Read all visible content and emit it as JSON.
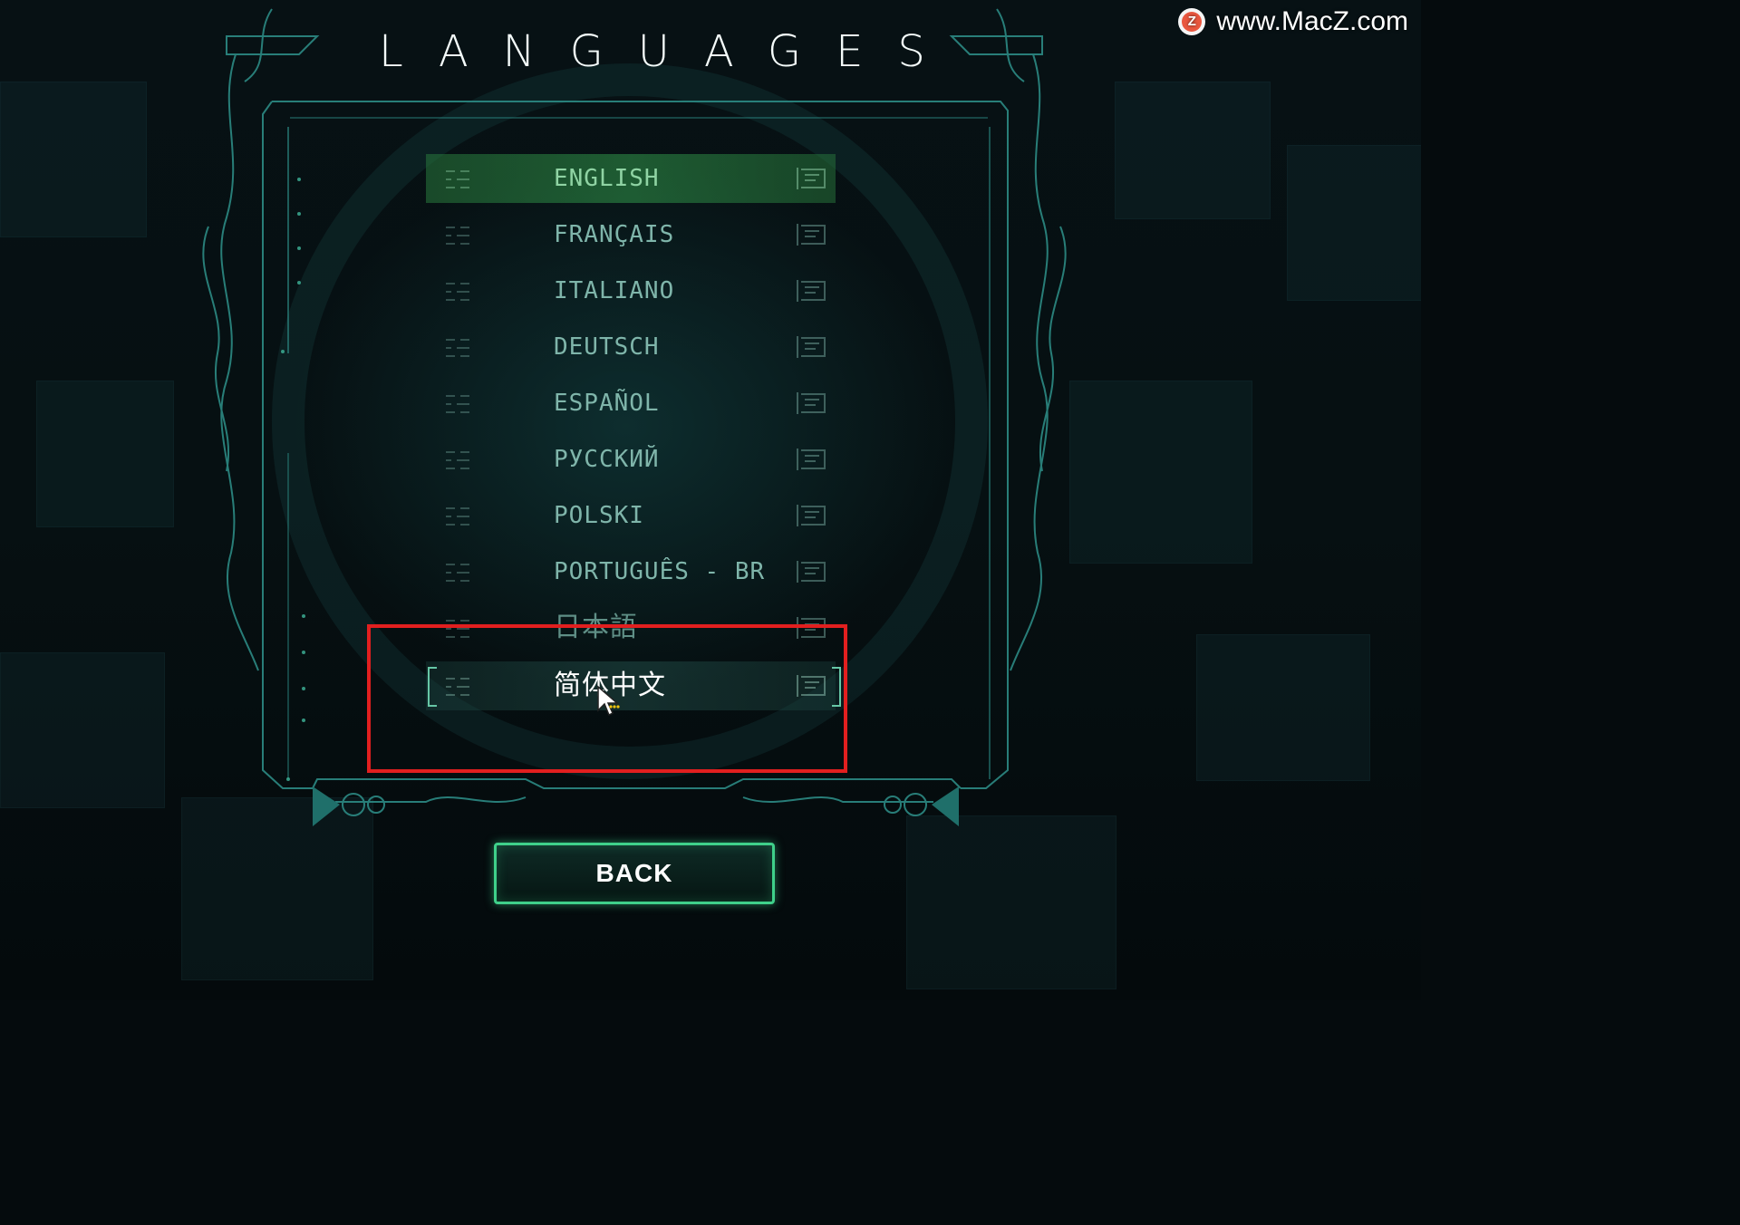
{
  "screen": {
    "title": "LANGUAGES",
    "watermark": "www.MacZ.com",
    "watermark_logo_letter": "Z"
  },
  "languages": {
    "items": [
      {
        "label": "ENGLISH",
        "state": "selected"
      },
      {
        "label": "FRANÇAIS",
        "state": "normal"
      },
      {
        "label": "ITALIANO",
        "state": "normal"
      },
      {
        "label": "DEUTSCH",
        "state": "normal"
      },
      {
        "label": "ESPAÑOL",
        "state": "normal"
      },
      {
        "label": "РУССКИЙ",
        "state": "normal"
      },
      {
        "label": "POLSKI",
        "state": "normal"
      },
      {
        "label": "PORTUGUÊS - BR",
        "state": "normal"
      },
      {
        "label": "日本語",
        "state": "dim"
      },
      {
        "label": "简体中文",
        "state": "hover"
      }
    ]
  },
  "back_button": {
    "label": "BACK"
  },
  "colors": {
    "background": "#050b0d",
    "frame_line": "#2c8a84",
    "selected_row": "#2d8c46",
    "text_normal": "#7fb5aa",
    "text_hover": "#ffffff",
    "button_border": "#3fd08a",
    "annotation_box": "#e21f1f",
    "watermark_logo": "#e9573f"
  },
  "icons": {
    "cursor": "mouse-pointer-icon",
    "row_left_decoration": "circuit-glyph-icon",
    "row_right_decoration": "panel-glyph-icon",
    "watermark_logo": "macz-logo-icon"
  }
}
